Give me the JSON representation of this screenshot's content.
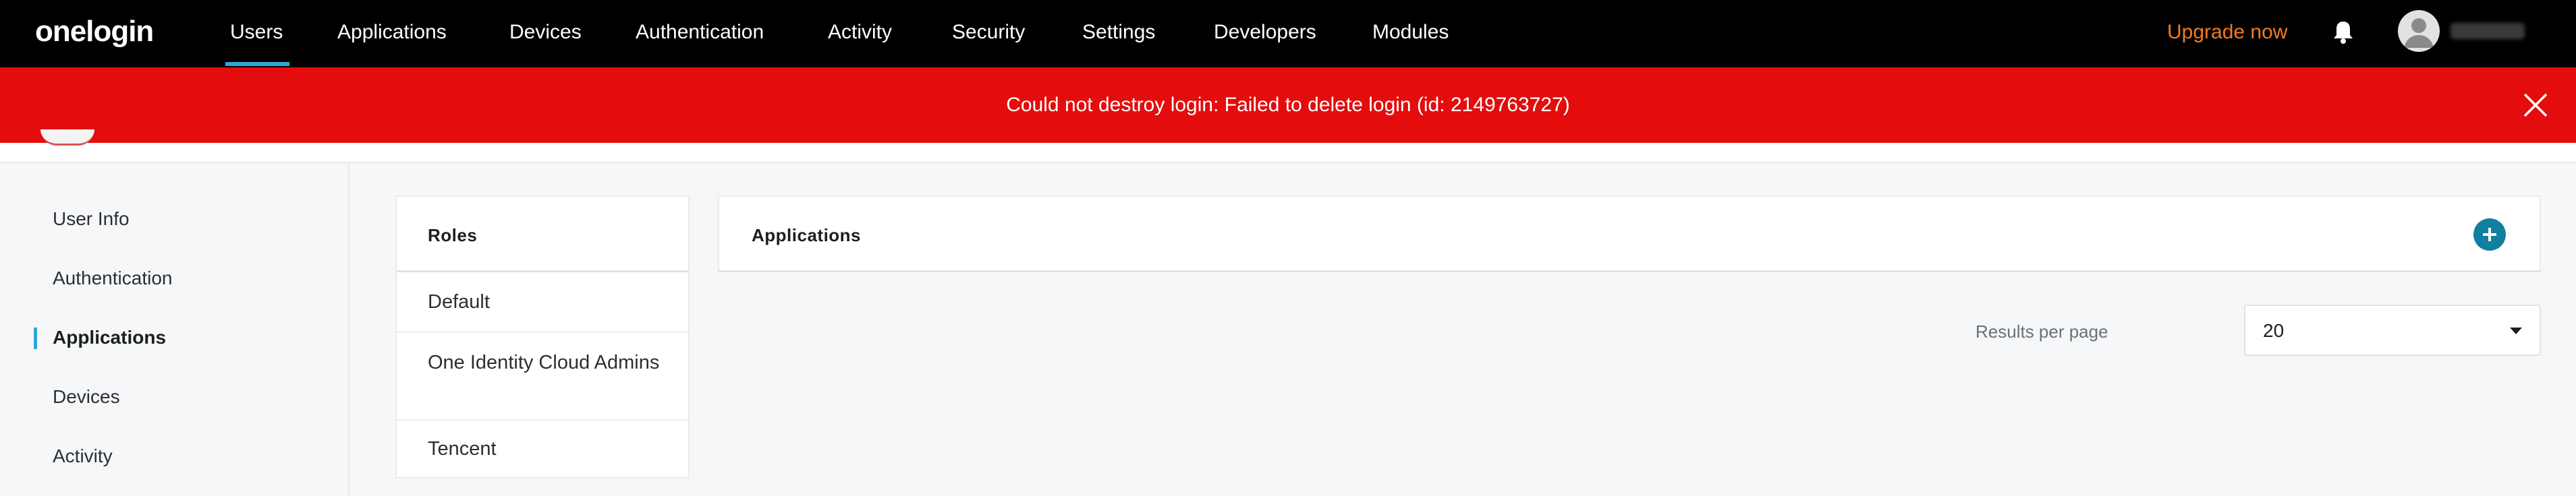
{
  "topnav": {
    "logo": "onelogin",
    "items": [
      {
        "label": "Users"
      },
      {
        "label": "Applications"
      },
      {
        "label": "Devices"
      },
      {
        "label": "Authentication"
      },
      {
        "label": "Activity"
      },
      {
        "label": "Security"
      },
      {
        "label": "Settings"
      },
      {
        "label": "Developers"
      },
      {
        "label": "Modules"
      }
    ],
    "active_item": "Users",
    "upgrade_label": "Upgrade now",
    "accent_color": "#2fa6d8",
    "upgrade_color": "#f47a1f"
  },
  "banner": {
    "message": "Could not destroy login: Failed to delete login (id: 2149763727)",
    "background_color": "#e40c0c",
    "close_icon": "close-icon"
  },
  "left_menu": {
    "items": [
      {
        "label": "User Info"
      },
      {
        "label": "Authentication"
      },
      {
        "label": "Applications"
      },
      {
        "label": "Devices"
      },
      {
        "label": "Activity"
      }
    ],
    "active_item": "Applications"
  },
  "roles": {
    "title": "Roles",
    "items": [
      {
        "label": "Default"
      },
      {
        "label": "One Identity Cloud Admins"
      },
      {
        "label": "Tencent"
      }
    ]
  },
  "applications": {
    "title": "Applications",
    "add_icon": "plus-icon",
    "add_color": "#117fa0",
    "results_per_page_label": "Results per page",
    "results_per_page_value": "20"
  }
}
